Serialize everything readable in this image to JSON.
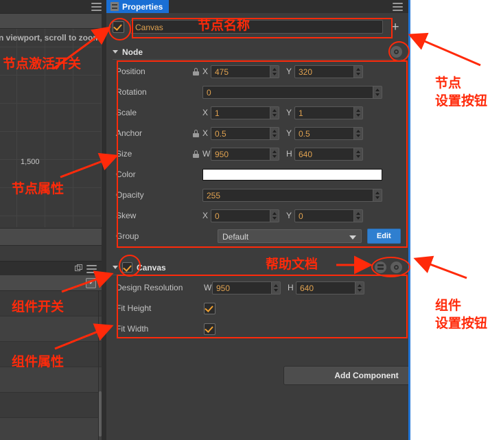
{
  "window": {
    "title": "Cocos Creator Properties Panel"
  },
  "left_panel": {
    "viewport_hint": "n viewport, scroll to zoom.",
    "ruler_tick": "1,500",
    "top_menu_icon": "hamburger-icon",
    "panel2_icons": [
      "copy-icon",
      "hamburger-icon"
    ],
    "panel3_icon": "dropdown-box-icon"
  },
  "properties_panel": {
    "tab": {
      "label": "Properties",
      "icon": "list-icon"
    },
    "menu_icon": "hamburger-icon",
    "node_name": {
      "value": "Canvas",
      "enabled": true
    },
    "add_icon": "plus-icon",
    "node_section": {
      "title": "Node",
      "settings_icon": "gear-icon",
      "rows": [
        {
          "label": "Position",
          "locked": true,
          "fields": [
            {
              "axis": "X",
              "value": "475"
            },
            {
              "axis": "Y",
              "value": "320"
            }
          ]
        },
        {
          "label": "Rotation",
          "locked": false,
          "fields": [
            {
              "axis": "",
              "value": "0"
            }
          ]
        },
        {
          "label": "Scale",
          "locked": false,
          "fields": [
            {
              "axis": "X",
              "value": "1"
            },
            {
              "axis": "Y",
              "value": "1"
            }
          ]
        },
        {
          "label": "Anchor",
          "locked": true,
          "fields": [
            {
              "axis": "X",
              "value": "0.5"
            },
            {
              "axis": "Y",
              "value": "0.5"
            }
          ]
        },
        {
          "label": "Size",
          "locked": true,
          "fields": [
            {
              "axis": "W",
              "value": "950"
            },
            {
              "axis": "H",
              "value": "640"
            }
          ]
        },
        {
          "label": "Color",
          "locked": false,
          "swatch": "#ffffff"
        },
        {
          "label": "Opacity",
          "locked": false,
          "fields": [
            {
              "axis": "",
              "value": "255"
            }
          ]
        },
        {
          "label": "Skew",
          "locked": false,
          "fields": [
            {
              "axis": "X",
              "value": "0"
            },
            {
              "axis": "Y",
              "value": "0"
            }
          ]
        },
        {
          "label": "Group",
          "locked": false,
          "select": "Default",
          "button": "Edit"
        }
      ]
    },
    "canvas_component": {
      "title": "Canvas",
      "enabled": true,
      "help_icon": "book-icon",
      "settings_icon": "gear-icon",
      "rows": [
        {
          "label": "Design Resolution",
          "fields": [
            {
              "axis": "W",
              "value": "950"
            },
            {
              "axis": "H",
              "value": "640"
            }
          ]
        },
        {
          "label": "Fit Height",
          "checked": true
        },
        {
          "label": "Fit Width",
          "checked": true
        }
      ]
    },
    "add_component_button": "Add Component"
  },
  "annotations": [
    {
      "id": "node-active-switch",
      "text": "节点激活开关"
    },
    {
      "id": "node-name",
      "text": "节点名称"
    },
    {
      "id": "node-settings-button",
      "text_line1": "节点",
      "text_line2": "设置按钮"
    },
    {
      "id": "node-properties",
      "text": "节点属性"
    },
    {
      "id": "component-switch",
      "text": "组件开关"
    },
    {
      "id": "help-doc",
      "text": "帮助文档"
    },
    {
      "id": "component-settings-button",
      "text_line1": "组件",
      "text_line2": "设置按钮"
    },
    {
      "id": "component-properties",
      "text": "组件属性"
    }
  ],
  "colors": {
    "accent_blue": "#1a6fd4",
    "value_orange": "#e0a250",
    "annotation_red": "#ff2a0a",
    "panel_bg": "#3c3c3c"
  }
}
